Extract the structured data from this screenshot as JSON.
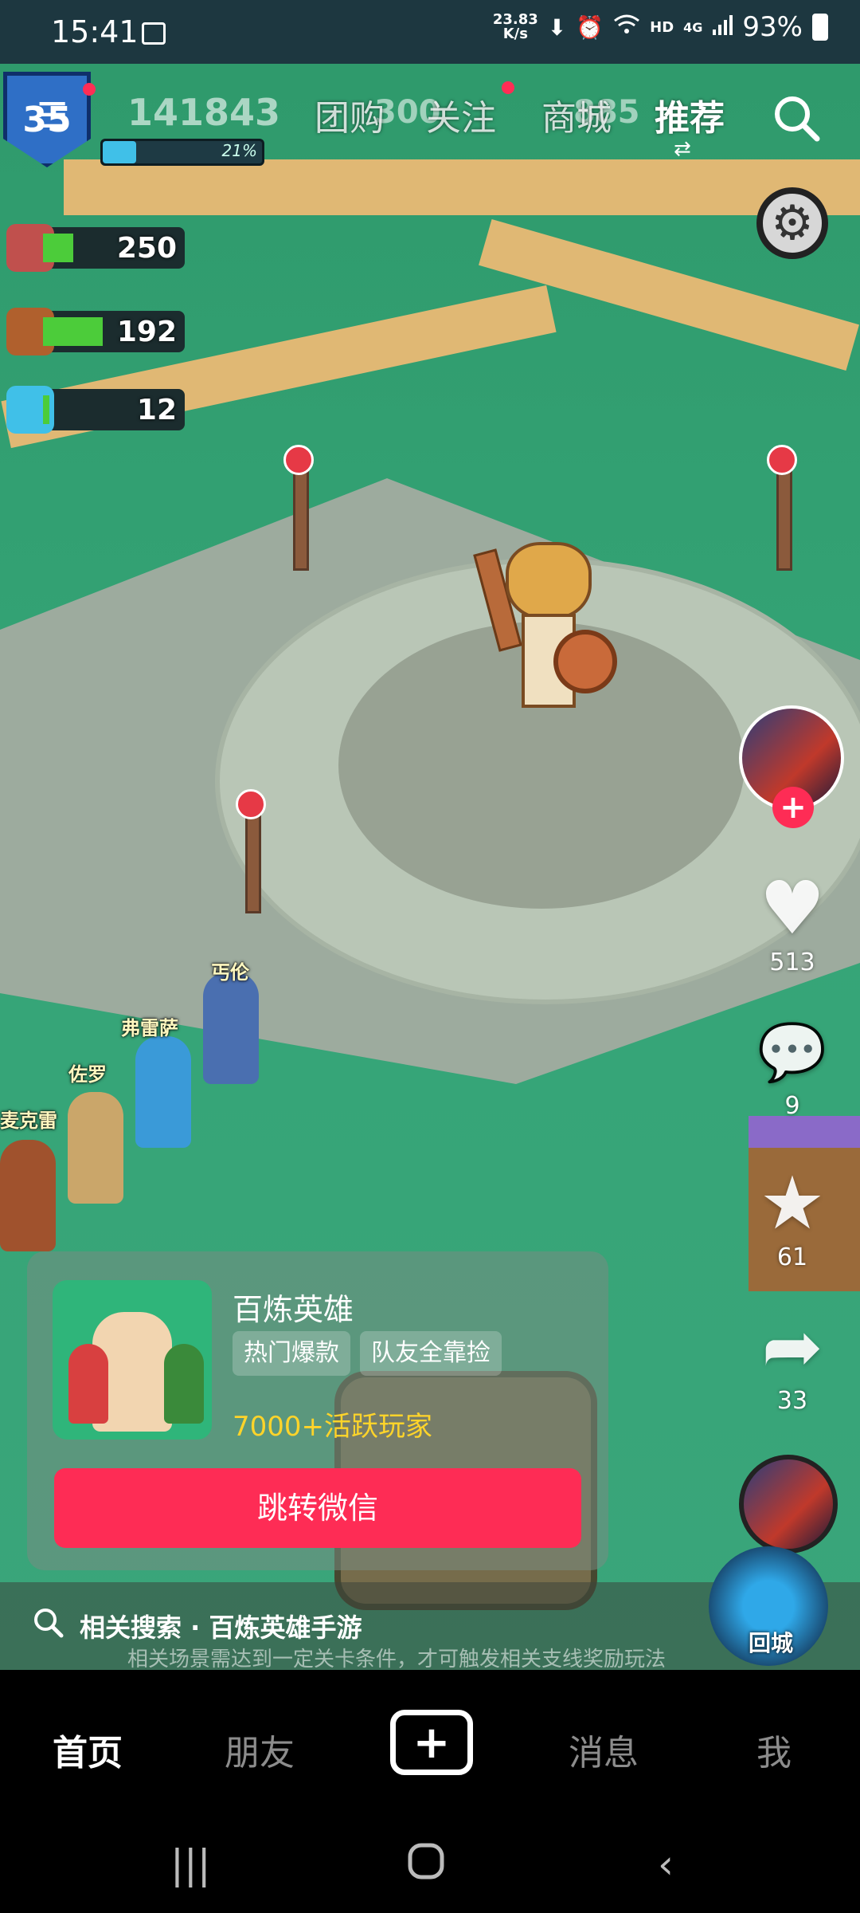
{
  "status_bar": {
    "time": "15:41",
    "speed_value": "23.83",
    "speed_unit": "K/s",
    "hd": "HD",
    "network": "4G",
    "battery": "93%"
  },
  "top_nav": {
    "menu_icon": "hamburger-icon",
    "tabs": [
      {
        "label": "团购"
      },
      {
        "label": "关注"
      },
      {
        "label": "商城"
      },
      {
        "label": "推荐"
      }
    ],
    "active_tab": "推荐",
    "search_icon": "search-icon"
  },
  "game_hud": {
    "level": "35",
    "xp_percent": "21%",
    "xp_fraction": 0.21,
    "score_overlay": "141843",
    "coin_overlay": "300",
    "gem_overlay": "885",
    "resources": [
      {
        "name": "meat",
        "value": "250",
        "fill": 0.25
      },
      {
        "name": "wood",
        "value": "192",
        "fill": 0.5
      },
      {
        "name": "crystal",
        "value": "12",
        "fill": 0.05
      }
    ]
  },
  "heroes": [
    {
      "name": "丐伦"
    },
    {
      "name": "弗雷萨"
    },
    {
      "name": "佐罗"
    },
    {
      "name": "麦克雷"
    }
  ],
  "actions": {
    "likes": "513",
    "comments": "9",
    "favorites": "61",
    "shares": "33"
  },
  "ad_card": {
    "title": "百炼英雄",
    "tags": [
      "热门爆款",
      "队友全靠捡"
    ],
    "players": "7000+活跃玩家",
    "button": "跳转微信"
  },
  "related_search": {
    "label": "相关搜索 · 百炼英雄手游",
    "subtitle": "相关场景需达到一定关卡条件，才可触发相关支线奖励玩法",
    "portal_label": "回城"
  },
  "bottom_nav": {
    "items": [
      {
        "label": "首页"
      },
      {
        "label": "朋友"
      },
      {
        "label": "消息"
      },
      {
        "label": "我"
      }
    ],
    "active": "首页"
  },
  "colors": {
    "accent": "#fe2c55",
    "players_text": "#ffd42a",
    "grass": "#35a577"
  }
}
